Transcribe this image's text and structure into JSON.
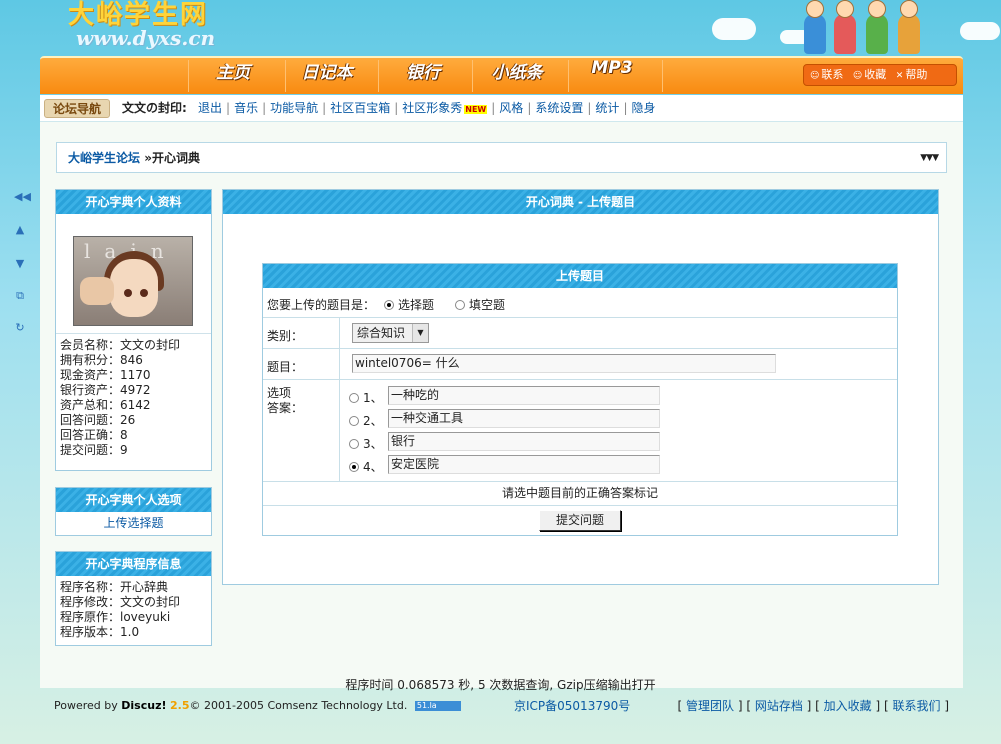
{
  "header": {
    "logo_title": "大峪学生网",
    "logo_url": "www.dyxs.cn"
  },
  "nav": {
    "items": [
      "主页",
      "日记本",
      "银行",
      "小纸条",
      "MP3"
    ],
    "tools": [
      "联系",
      "收藏",
      "帮助"
    ]
  },
  "forumnav": {
    "tag": "论坛导航",
    "user": "文文の封印:",
    "links": [
      "退出",
      "音乐",
      "功能导航",
      "社区百宝箱",
      "社区形象秀",
      "风格",
      "系统设置",
      "统计",
      "隐身"
    ],
    "new_badge": "NEW"
  },
  "breadcrumb": {
    "forum": "大峪学生论坛",
    "separator": "»",
    "current": "开心词典"
  },
  "profile": {
    "title": "开心字典个人资料",
    "avatar_text": "lain",
    "stats": [
      {
        "label": "会员名称：",
        "value": "文文の封印"
      },
      {
        "label": "拥有积分：",
        "value": "846"
      },
      {
        "label": "现金资产：",
        "value": "1170"
      },
      {
        "label": "银行资产：",
        "value": "4972"
      },
      {
        "label": "资产总和：",
        "value": "6142"
      },
      {
        "label": "回答问题：",
        "value": "26"
      },
      {
        "label": "回答正确：",
        "value": "8"
      },
      {
        "label": "提交问题：",
        "value": "9"
      }
    ]
  },
  "options": {
    "title": "开心字典个人选项",
    "link": "上传选择题"
  },
  "program": {
    "title": "开心字典程序信息",
    "rows": [
      "程序名称：开心辞典",
      "程序修改：文文の封印",
      "程序原作：loveyuki",
      "程序版本：1.0"
    ]
  },
  "main": {
    "title": "开心词典 - 上传题目",
    "form_title": "上传题目",
    "type_label": "您要上传的题目是：",
    "type_options": [
      "选择题",
      "填空题"
    ],
    "category_label": "类别：",
    "category_value": "综合知识",
    "question_label": "题目：",
    "question_value": "wintel0706= 什么",
    "options_label": [
      "选项",
      "答案："
    ],
    "answers": [
      {
        "num": "1、",
        "text": "一种吃的",
        "checked": false
      },
      {
        "num": "2、",
        "text": "一种交通工具",
        "checked": false
      },
      {
        "num": "3、",
        "text": "银行",
        "checked": false
      },
      {
        "num": "4、",
        "text": "安定医院",
        "checked": true
      }
    ],
    "hint": "请选中题目前的正确答案标记",
    "submit": "提交问题"
  },
  "footer": {
    "stats": "程序时间 0.068573 秒, 5 次数据查询, Gzip压缩输出打开",
    "powered_prefix": "Powered by",
    "brand": "Discuz!",
    "version": "2.5",
    "copyright": "© 2001-2005 Comsenz Technology Ltd.",
    "badge": "51.la",
    "icp": "京ICP备05013790号",
    "links": [
      "管理团队",
      "网站存档",
      "加入收藏",
      "联系我们"
    ]
  }
}
